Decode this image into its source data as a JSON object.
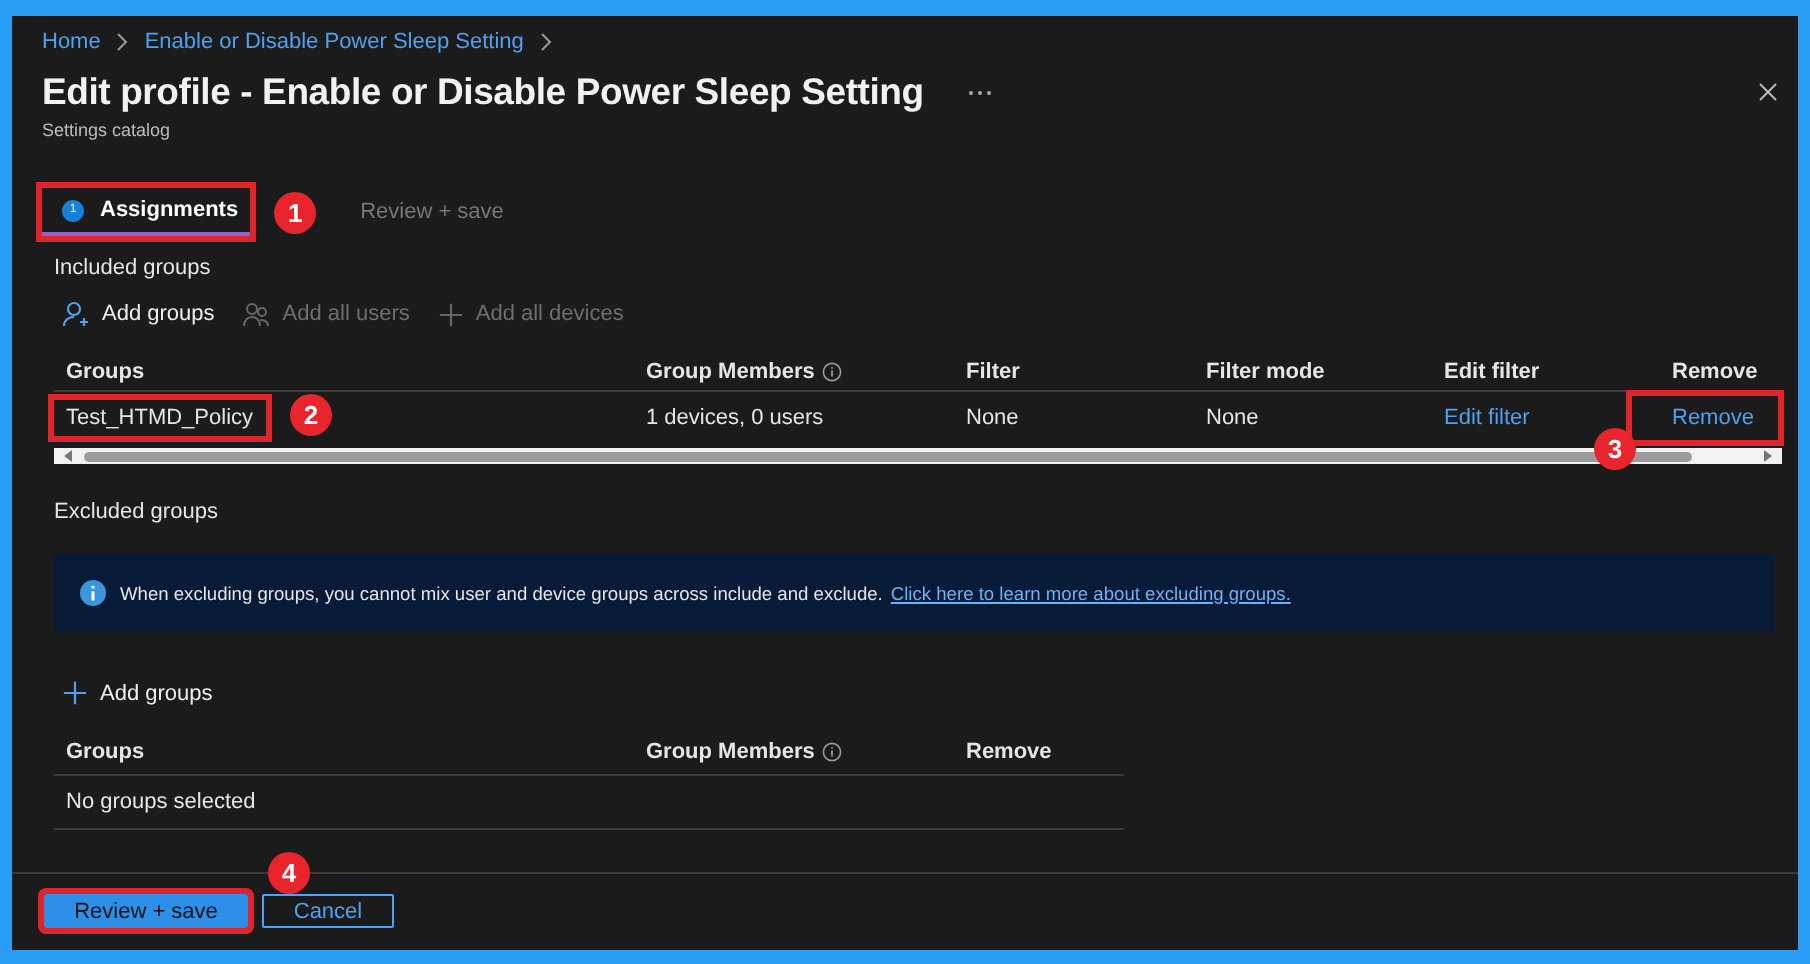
{
  "breadcrumb": [
    "Home",
    "Enable or Disable Power Sleep Setting"
  ],
  "title": "Edit profile - Enable or Disable Power Sleep Setting",
  "subtitle": "Settings catalog",
  "steps": [
    {
      "label": "Assignments",
      "number": "1",
      "selected": true,
      "callout": "1"
    },
    {
      "label": "Review + save",
      "selected": false
    }
  ],
  "included": {
    "heading": "Included groups",
    "actions": [
      {
        "label": "Add groups",
        "kind": "add-group",
        "disabled": false
      },
      {
        "label": "Add all users",
        "kind": "add-users",
        "disabled": true
      },
      {
        "label": "Add all devices",
        "kind": "add",
        "disabled": true
      }
    ],
    "columns": [
      {
        "label": "Groups",
        "info": false
      },
      {
        "label": "Group Members",
        "info": true
      },
      {
        "label": "Filter",
        "info": false
      },
      {
        "label": "Filter mode",
        "info": false
      },
      {
        "label": "Edit filter",
        "info": false
      },
      {
        "label": "Remove",
        "info": false
      }
    ],
    "rows": [
      {
        "group": "Test_HTMD_Policy",
        "group_callout": "2",
        "members": "1 devices, 0 users",
        "filter": "None",
        "filter_mode": "None",
        "edit_filter": "Edit filter",
        "remove": "Remove",
        "remove_callout": "3"
      }
    ]
  },
  "excluded": {
    "heading": "Excluded groups",
    "notice": {
      "text": "When excluding groups, you cannot mix user and device groups across include and exclude.",
      "link": "Click here to learn more about excluding groups."
    },
    "actions": [
      {
        "label": "Add groups",
        "kind": "add",
        "disabled": false
      }
    ],
    "columns": [
      {
        "label": "Groups",
        "info": false
      },
      {
        "label": "Group Members",
        "info": true
      },
      {
        "label": "Remove",
        "info": false
      }
    ],
    "empty": "No groups selected"
  },
  "footer": {
    "buttons": [
      {
        "label": "Review + save",
        "kind": "primary",
        "callout": "4"
      },
      {
        "label": "Cancel",
        "kind": "secondary"
      }
    ]
  }
}
